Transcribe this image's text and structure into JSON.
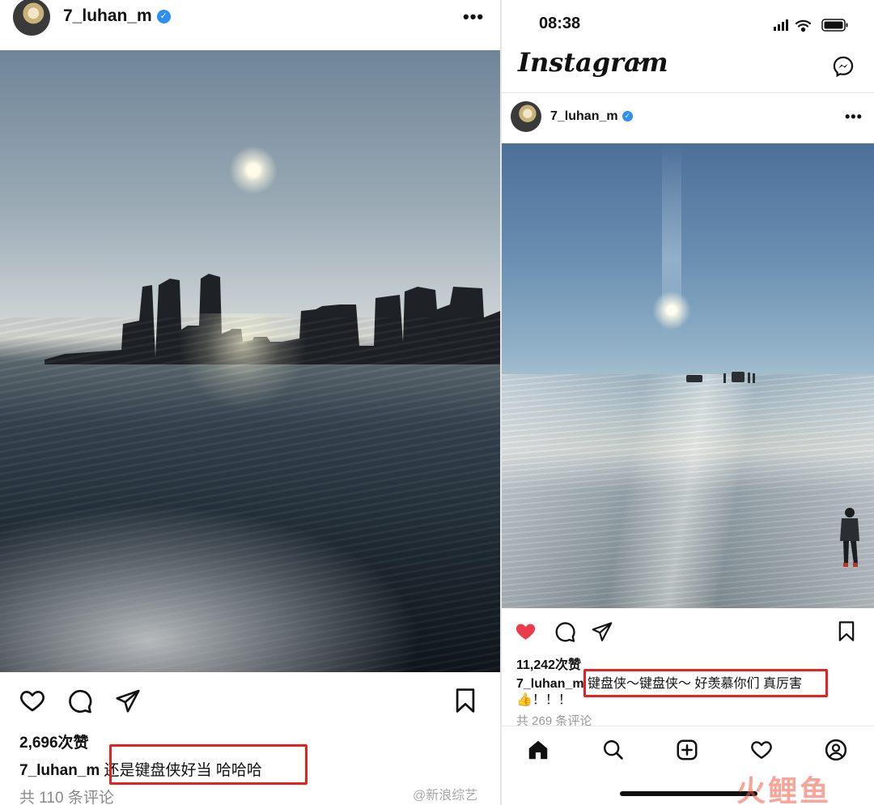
{
  "left_post": {
    "username": "7_luhan_m",
    "verified_mark": "✓",
    "more_label": "•••",
    "likes": "2,696次赞",
    "caption_user": "7_luhan_m",
    "caption_text": "还是键盘侠好当  哈哈哈",
    "comments": "共 110 条评论",
    "actions": [
      "heart-icon",
      "comment-icon",
      "share-icon",
      "bookmark-icon"
    ]
  },
  "watermark": "@新浪综艺",
  "right_post": {
    "status_time": "08:38",
    "app_title": "Instagram",
    "username": "7_luhan_m",
    "verified_mark": "✓",
    "more_label": "•••",
    "likes": "11,242次赞",
    "caption_user": "7_luhan_m",
    "caption_text": "键盘侠～键盘侠～ 好羡慕你们 真厉害 👍！！！",
    "comments": "共 269 条评论",
    "actions": [
      "heart-filled-icon",
      "comment-icon",
      "share-icon",
      "bookmark-icon"
    ],
    "tabbar": [
      "home-icon",
      "search-icon",
      "new-post-icon",
      "activity-heart-icon",
      "profile-icon"
    ]
  },
  "brand_watermark": "火鲤鱼",
  "colors": {
    "highlight_box": "#e8211f",
    "liked_heart": "#ed3b4e",
    "verified": "#2d8ff0"
  }
}
